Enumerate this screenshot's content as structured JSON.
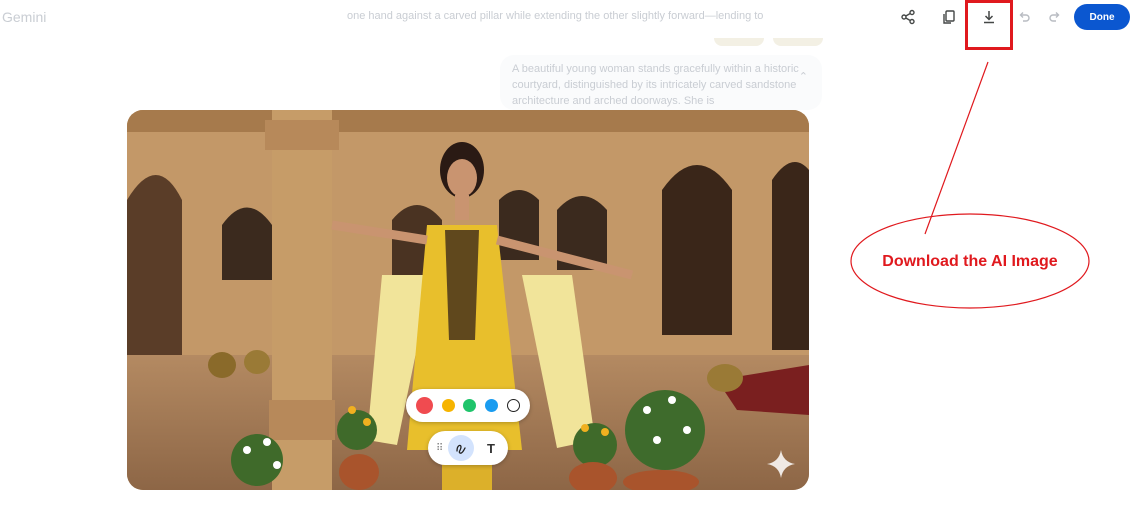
{
  "app": {
    "brand": "Gemini"
  },
  "prompt": {
    "top_line": "one hand against a carved pillar while extending the other slightly forward—lending to",
    "card_text": "A beautiful young woman stands gracefully within a historic courtyard, distinguished by its intricately carved sandstone architecture and arched doorways. She is"
  },
  "toolbar": {
    "share_icon": "share-icon",
    "copy_icon": "copy-icon",
    "download_icon": "download-icon",
    "undo_icon": "undo-icon",
    "redo_icon": "redo-icon",
    "done_label": "Done"
  },
  "annotation": {
    "callout_text": "Download the AI Image",
    "color": "#e0191e"
  },
  "editor": {
    "palette": [
      "#f04b50",
      "#f6b400",
      "#1fc46b",
      "#1a9cf0",
      "#ffffff"
    ],
    "selected_color": "#f04b50",
    "tools": {
      "draw_icon": "draw-icon",
      "text_label": "T"
    }
  },
  "colors": {
    "accent": "#0b57d0"
  }
}
